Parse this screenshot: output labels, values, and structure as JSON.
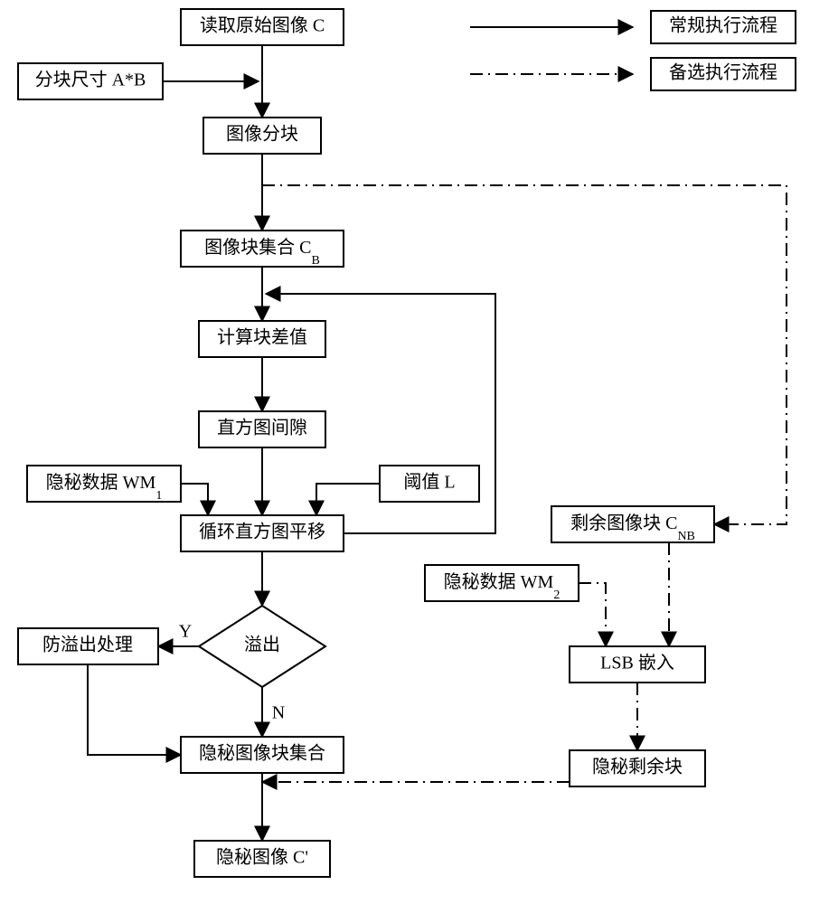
{
  "chart_data": {
    "type": "flowchart",
    "title": "",
    "nodes": [
      {
        "id": "read_c",
        "label": "读取原始图像 C",
        "shape": "rect"
      },
      {
        "id": "block_size",
        "label": "分块尺寸 A*B",
        "shape": "rect"
      },
      {
        "id": "split",
        "label": "图像分块",
        "shape": "rect"
      },
      {
        "id": "cb",
        "label": "图像块集合 C_B",
        "shape": "rect",
        "sub": "B"
      },
      {
        "id": "calc_diff",
        "label": "计算块差值",
        "shape": "rect"
      },
      {
        "id": "hist_gap",
        "label": "直方图间隙",
        "shape": "rect"
      },
      {
        "id": "wm1",
        "label": "隐秘数据 WM_1",
        "shape": "rect",
        "sub": "1"
      },
      {
        "id": "thresh_l",
        "label": "阈值 L",
        "shape": "rect"
      },
      {
        "id": "loop_shift",
        "label": "循环直方图平移",
        "shape": "rect"
      },
      {
        "id": "overflow",
        "label": "溢出",
        "shape": "diamond"
      },
      {
        "id": "anti_overflow",
        "label": "防溢出处理",
        "shape": "rect"
      },
      {
        "id": "secret_blocks",
        "label": "隐秘图像块集合",
        "shape": "rect"
      },
      {
        "id": "secret_image",
        "label": "隐秘图像 C'",
        "shape": "rect"
      },
      {
        "id": "cnb",
        "label": "剩余图像块 C_NB",
        "shape": "rect",
        "sub": "NB"
      },
      {
        "id": "wm2",
        "label": "隐秘数据 WM_2",
        "shape": "rect",
        "sub": "2"
      },
      {
        "id": "lsb",
        "label": "LSB 嵌入",
        "shape": "rect"
      },
      {
        "id": "secret_rest",
        "label": "隐秘剩余块",
        "shape": "rect"
      }
    ],
    "edges": [
      {
        "from": "read_c",
        "to": "split",
        "style": "solid"
      },
      {
        "from": "block_size",
        "to": "split",
        "style": "solid"
      },
      {
        "from": "split",
        "to": "cb",
        "style": "solid"
      },
      {
        "from": "cb",
        "to": "calc_diff",
        "style": "solid"
      },
      {
        "from": "calc_diff",
        "to": "hist_gap",
        "style": "solid"
      },
      {
        "from": "hist_gap",
        "to": "loop_shift",
        "style": "solid"
      },
      {
        "from": "wm1",
        "to": "loop_shift",
        "style": "solid"
      },
      {
        "from": "thresh_l",
        "to": "loop_shift",
        "style": "solid"
      },
      {
        "from": "loop_shift",
        "to": "overflow",
        "style": "solid"
      },
      {
        "from": "overflow",
        "to": "anti_overflow",
        "label": "Y",
        "style": "solid"
      },
      {
        "from": "overflow",
        "to": "secret_blocks",
        "label": "N",
        "style": "solid"
      },
      {
        "from": "anti_overflow",
        "to": "secret_blocks",
        "style": "solid"
      },
      {
        "from": "secret_blocks",
        "to": "secret_image",
        "style": "solid"
      },
      {
        "from": "loop_shift",
        "to": "calc_diff",
        "style": "solid",
        "note": "back-edge"
      },
      {
        "from": "split",
        "to": "cnb",
        "style": "dashed"
      },
      {
        "from": "cnb",
        "to": "lsb",
        "style": "dashed"
      },
      {
        "from": "wm2",
        "to": "lsb",
        "style": "dashed"
      },
      {
        "from": "lsb",
        "to": "secret_rest",
        "style": "dashed"
      },
      {
        "from": "secret_rest",
        "to": "secret_image",
        "style": "dashed"
      }
    ],
    "decision_labels": {
      "yes": "Y",
      "no": "N"
    },
    "legend": [
      {
        "style": "solid",
        "label": "常规执行流程"
      },
      {
        "style": "dashed",
        "label": "备选执行流程"
      }
    ]
  },
  "nodes": {
    "read_c": "读取原始图像 C",
    "block_size": "分块尺寸 A*B",
    "split": "图像分块",
    "cb_pre": "图像块集合 C",
    "cb_sub": "B",
    "calc_diff": "计算块差值",
    "hist_gap": "直方图间隙",
    "wm1_pre": "隐秘数据 WM",
    "wm1_sub": "1",
    "thresh_l": "阈值 L",
    "loop_shift": "循环直方图平移",
    "overflow": "溢出",
    "anti_overflow": "防溢出处理",
    "secret_blocks": "隐秘图像块集合",
    "secret_image": "隐秘图像 C'",
    "cnb_pre": "剩余图像块 C",
    "cnb_sub": "NB",
    "wm2_pre": "隐秘数据 WM",
    "wm2_sub": "2",
    "lsb": "LSB 嵌入",
    "secret_rest": "隐秘剩余块"
  },
  "labels": {
    "yes": "Y",
    "no": "N"
  },
  "legend": {
    "solid": "常规执行流程",
    "dashed": "备选执行流程"
  }
}
